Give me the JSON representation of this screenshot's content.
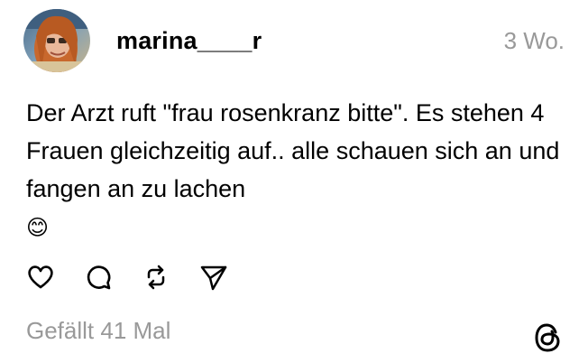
{
  "post": {
    "username": "marina____r",
    "timestamp": "3 Wo.",
    "text": "Der Arzt ruft \"frau rosenkranz bitte\". Es stehen 4 Frauen gleichzeitig auf.. alle schauen sich an und fangen an zu lachen",
    "emoji": "😊",
    "likes": "Gefällt 41 Mal"
  },
  "icons": {
    "like": "heart-icon",
    "comment": "comment-bubble-icon",
    "repost": "repost-icon",
    "share": "send-icon",
    "brand": "threads-logo-icon"
  },
  "colors": {
    "text": "#000000",
    "muted": "#999999",
    "background": "#ffffff"
  }
}
